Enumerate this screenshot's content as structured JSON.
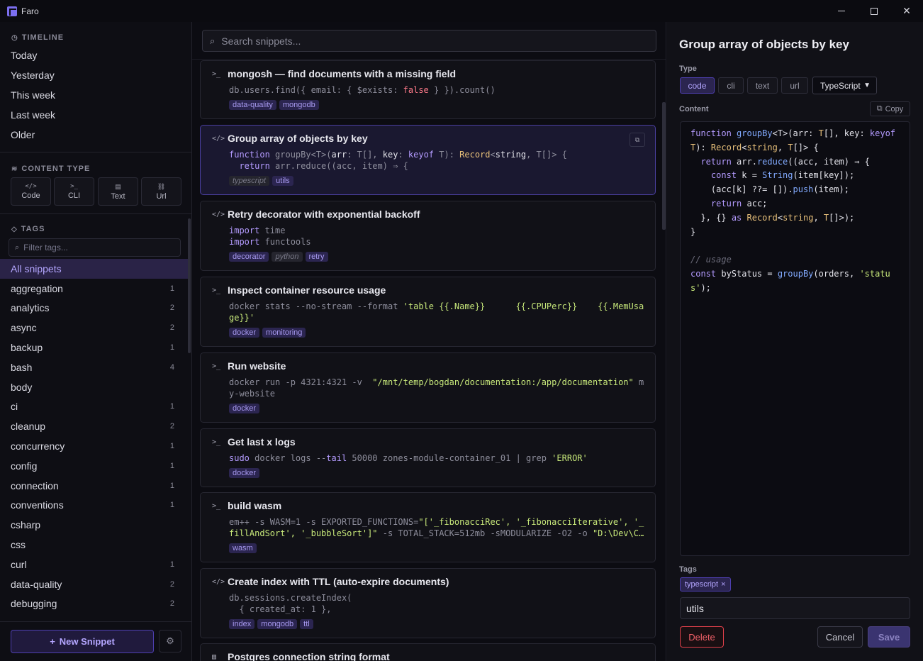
{
  "window": {
    "title": "Faro"
  },
  "sidebar": {
    "timeline_title": "TIMELINE",
    "timeline": [
      "Today",
      "Yesterday",
      "This week",
      "Last week",
      "Older"
    ],
    "content_type_title": "CONTENT TYPE",
    "content_types": [
      {
        "glyph": "</>",
        "label": "Code"
      },
      {
        "glyph": ">_",
        "label": "CLI"
      },
      {
        "glyph": "▤",
        "label": "Text"
      },
      {
        "glyph": "⛓",
        "label": "Url"
      }
    ],
    "tags_title": "TAGS",
    "filter_placeholder": "Filter tags...",
    "tags": [
      {
        "name": "All snippets",
        "count": ""
      },
      {
        "name": "aggregation",
        "count": "1"
      },
      {
        "name": "analytics",
        "count": "2"
      },
      {
        "name": "async",
        "count": "2"
      },
      {
        "name": "backup",
        "count": "1"
      },
      {
        "name": "bash",
        "count": "4"
      },
      {
        "name": "body",
        "count": ""
      },
      {
        "name": "ci",
        "count": "1"
      },
      {
        "name": "cleanup",
        "count": "2"
      },
      {
        "name": "concurrency",
        "count": "1"
      },
      {
        "name": "config",
        "count": "1"
      },
      {
        "name": "connection",
        "count": "1"
      },
      {
        "name": "conventions",
        "count": "1"
      },
      {
        "name": "csharp",
        "count": ""
      },
      {
        "name": "css",
        "count": ""
      },
      {
        "name": "curl",
        "count": "1"
      },
      {
        "name": "data-quality",
        "count": "2"
      },
      {
        "name": "debugging",
        "count": "2"
      }
    ],
    "new_snippet_label": "New Snippet"
  },
  "search": {
    "placeholder": "Search snippets..."
  },
  "snippets": [
    {
      "kind": ">_",
      "title": "mongosh — find documents with a missing field",
      "tags": [
        "data-quality",
        "mongodb"
      ]
    },
    {
      "kind": "</>",
      "title": "Group array of objects by key",
      "tags": [
        "typescript",
        "utils"
      ]
    },
    {
      "kind": "</>",
      "title": "Retry decorator with exponential backoff",
      "tags": [
        "decorator",
        "python",
        "retry"
      ]
    },
    {
      "kind": ">_",
      "title": "Inspect container resource usage",
      "tags": [
        "docker",
        "monitoring"
      ]
    },
    {
      "kind": ">_",
      "title": "Run website",
      "tags": [
        "docker"
      ]
    },
    {
      "kind": ">_",
      "title": "Get last x logs",
      "tags": [
        "docker"
      ]
    },
    {
      "kind": ">_",
      "title": "build wasm",
      "tags": [
        "wasm"
      ]
    },
    {
      "kind": "</>",
      "title": "Create index with TTL (auto-expire documents)",
      "tags": [
        "index",
        "mongodb",
        "ttl"
      ]
    },
    {
      "kind": "▤",
      "title": "Postgres connection string format",
      "tags": []
    }
  ],
  "detail": {
    "title": "Group array of objects by key",
    "type_label": "Type",
    "types": [
      "code",
      "cli",
      "text",
      "url"
    ],
    "language": "TypeScript",
    "content_label": "Content",
    "copy_label": "Copy",
    "tags_label": "Tags",
    "tag": "typescript",
    "tag_input_value": "utils",
    "delete_label": "Delete",
    "cancel_label": "Cancel",
    "save_label": "Save"
  }
}
